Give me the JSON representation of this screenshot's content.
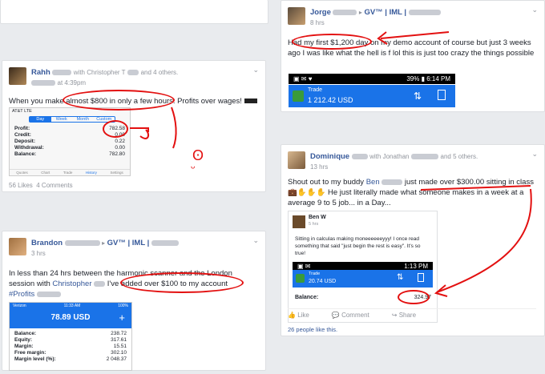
{
  "post_jorge": {
    "name": "Jorge",
    "group": "GV™ | IML |",
    "time": "8 hrs",
    "text": "Had my first $1,200 day on my demo account of course but just 3 weeks ago I was like what the hell is f lol this is just too crazy the things possible",
    "status_time": "6:14 PM",
    "status_battery": "39%",
    "trade_label": "Trade",
    "trade_value": "1 212.42 USD"
  },
  "post_rahh": {
    "name": "Rahh",
    "with_text": "with Christopher T",
    "others": "and 4 others.",
    "time": "at 4:39pm",
    "text": "When you make almost $800 in only a few hours. Profits over wages!",
    "carrier": "AT&T  LTE",
    "tabs": [
      "Day",
      "Week",
      "Month",
      "Custom"
    ],
    "rows": [
      {
        "label": "Profit:",
        "value": "782.58"
      },
      {
        "label": "Credit:",
        "value": "0.00"
      },
      {
        "label": "Deposit:",
        "value": "0.22"
      },
      {
        "label": "Withdrawal:",
        "value": "0.00"
      },
      {
        "label": "Balance:",
        "value": "782.80"
      }
    ],
    "nav": [
      "Quotes",
      "Chart",
      "Trade",
      "History",
      "Settings"
    ],
    "likes": "56 Likes",
    "comments": "4 Comments"
  },
  "post_dominique": {
    "name": "Dominique",
    "with_text": "with Jonathan",
    "others": "and 5 others.",
    "time": "13 hrs",
    "text_a": "Shout out to my buddy",
    "mention": "Ben",
    "text_b": "just made over $300.00 sitting in class",
    "text_c": "He just literally made what someone makes in a week at a average 9 to 5 job... in a Day...",
    "inner_name": "Ben W",
    "inner_time": "5 hrs",
    "inner_text": "Sitting in calculas making moneeeeeeyyy! I once read something that said \"just begin the rest is easy\". It's so true!",
    "status_time": "1:13 PM",
    "trade_label": "Trade",
    "trade_value": "20.74 USD",
    "balance_label": "Balance:",
    "balance_value": "324.97",
    "like_label": "Like",
    "comment_label": "Comment",
    "share_label": "Share",
    "likes_text": "26 people like this."
  },
  "post_brandon": {
    "name": "Brandon",
    "group": "GV™ | IML |",
    "time": "3 hrs",
    "text_a": "In less than 24 hrs between the harmonic scanner and the London session with",
    "mention": "Christopher",
    "text_b": "I've added over $100 to my account",
    "hashtag": "#Profits",
    "carrier": "Verizon",
    "status_time": "11:33 AM",
    "battery": "100%",
    "balance_big": "78.89 USD",
    "rows": [
      {
        "label": "Balance:",
        "value": "238.72"
      },
      {
        "label": "Equity:",
        "value": "317.61"
      },
      {
        "label": "Margin:",
        "value": "15.51"
      },
      {
        "label": "Free margin:",
        "value": "302.10"
      },
      {
        "label": "Margin level (%):",
        "value": "2 048.37"
      }
    ]
  },
  "colors": {
    "accent": "#365899",
    "ink": "#e31010",
    "trade_blue": "#1a73e8"
  }
}
